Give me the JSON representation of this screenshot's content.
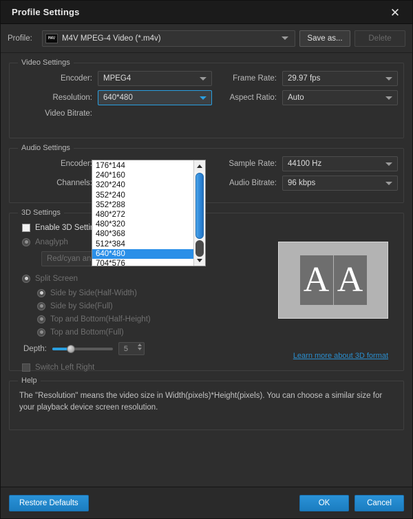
{
  "window": {
    "title": "Profile Settings",
    "close_label": "✕"
  },
  "profile": {
    "label": "Profile:",
    "icon_text": "M4V",
    "value": "M4V MPEG-4 Video (*.m4v)",
    "save_as_label": "Save as...",
    "delete_label": "Delete"
  },
  "video_settings": {
    "legend": "Video Settings",
    "encoder_label": "Encoder:",
    "encoder_value": "MPEG4",
    "resolution_label": "Resolution:",
    "resolution_value": "640*480",
    "video_bitrate_label": "Video Bitrate:",
    "frame_rate_label": "Frame Rate:",
    "frame_rate_value": "29.97 fps",
    "aspect_ratio_label": "Aspect Ratio:",
    "aspect_ratio_value": "Auto"
  },
  "resolution_dropdown": {
    "open": true,
    "selected": "640*480",
    "options": [
      "176*144",
      "240*160",
      "320*240",
      "352*240",
      "352*288",
      "480*272",
      "480*320",
      "480*368",
      "512*384",
      "640*480",
      "704*576"
    ],
    "scroll_up_icon": "triangle-up-icon",
    "scroll_down_icon": "triangle-down-icon"
  },
  "audio_settings": {
    "legend": "Audio Settings",
    "encoder_label": "Encoder:",
    "channels_label": "Channels:",
    "sample_rate_label": "Sample Rate:",
    "sample_rate_value": "44100 Hz",
    "audio_bitrate_label": "Audio Bitrate:",
    "audio_bitrate_value": "96 kbps"
  },
  "three_d_settings": {
    "legend": "3D Settings",
    "enable_label": "Enable 3D Settings",
    "enable_checked": false,
    "anaglyph_label": "Anaglyph",
    "anaglyph_selected": false,
    "anaglyph_mode_value": "Red/cyan anaglyph, full color",
    "split_screen_label": "Split Screen",
    "split_screen_selected": true,
    "split_options": [
      {
        "label": "Side by Side(Half-Width)",
        "selected": true
      },
      {
        "label": "Side by Side(Full)",
        "selected": false
      },
      {
        "label": "Top and Bottom(Half-Height)",
        "selected": false
      },
      {
        "label": "Top and Bottom(Full)",
        "selected": false
      }
    ],
    "depth_label": "Depth:",
    "depth_value": "5",
    "switch_left_right_label": "Switch Left Right",
    "switch_left_right_checked": false,
    "learn_more_label": "Learn more about 3D format",
    "preview_left_letter": "A",
    "preview_right_letter": "A"
  },
  "help": {
    "legend": "Help",
    "text": "The \"Resolution\" means the video size in Width(pixels)*Height(pixels).  You can choose a similar size for your playback device screen resolution."
  },
  "footer": {
    "restore_defaults_label": "Restore Defaults",
    "ok_label": "OK",
    "cancel_label": "Cancel"
  },
  "colors": {
    "accent_blue": "#2a93d8",
    "selection_blue": "#2a8fe8",
    "link_blue": "#2a8fd0",
    "window_bg": "#2e2e2e",
    "titlebar_bg": "#1b1b1b"
  }
}
